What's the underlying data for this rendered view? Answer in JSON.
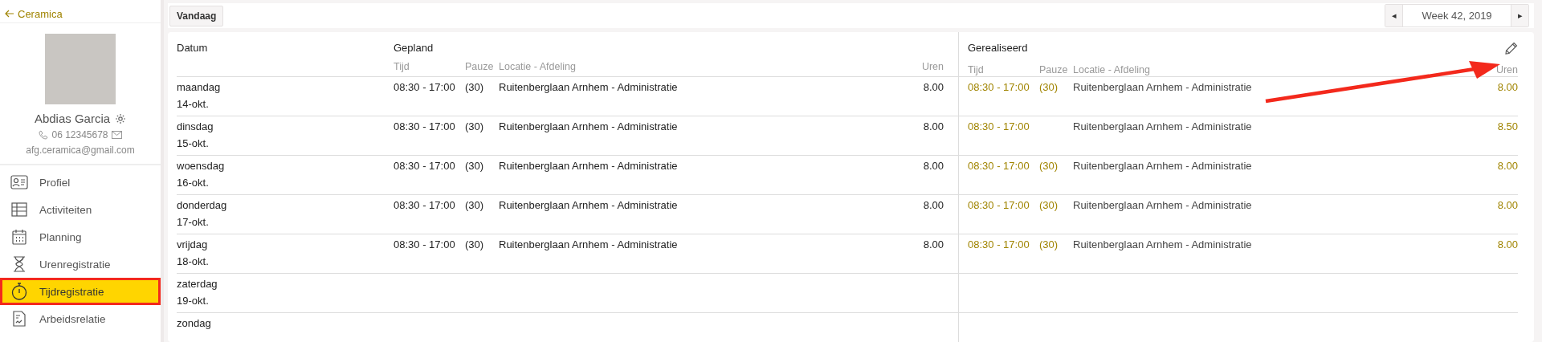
{
  "sidebar": {
    "back_link": "Ceramica",
    "profile": {
      "name": "Abdias Garcia",
      "phone": "06 12345678",
      "email": "afg.ceramica@gmail.com"
    },
    "nav_items": [
      {
        "label": "Profiel",
        "selected": false,
        "highlighted": false
      },
      {
        "label": "Activiteiten",
        "selected": false,
        "highlighted": false
      },
      {
        "label": "Planning",
        "selected": false,
        "highlighted": false
      },
      {
        "label": "Urenregistratie",
        "selected": false,
        "highlighted": false
      },
      {
        "label": "Tijdregistratie",
        "selected": true,
        "highlighted": true
      },
      {
        "label": "Arbeidsrelatie",
        "selected": false,
        "highlighted": false
      }
    ]
  },
  "toolbar": {
    "today_button": "Vandaag",
    "prev": "◂",
    "week": "Week 42, 2019",
    "next": "▸"
  },
  "table": {
    "date_column": "Datum",
    "planned": {
      "title": "Gepland",
      "columns": [
        "Tijd",
        "Pauze",
        "Locatie - Afdeling",
        "Uren"
      ]
    },
    "realized": {
      "title": "Gerealiseerd",
      "columns": [
        "Tijd",
        "Pauze",
        "Locatie - Afdeling",
        "Uren"
      ]
    },
    "rows": [
      {
        "day": "maandag",
        "date": "14-okt.",
        "planned": {
          "time": "08:30 - 17:00",
          "pause": "(30)",
          "location": "Ruitenberglaan Arnhem - Administratie",
          "hours": "8.00"
        },
        "realized": {
          "time": "08:30 - 17:00",
          "pause": "(30)",
          "location": "Ruitenberglaan Arnhem - Administratie",
          "hours": "8.00"
        }
      },
      {
        "day": "dinsdag",
        "date": "15-okt.",
        "planned": {
          "time": "08:30 - 17:00",
          "pause": "(30)",
          "location": "Ruitenberglaan Arnhem - Administratie",
          "hours": "8.00"
        },
        "realized": {
          "time": "08:30 - 17:00",
          "location": "Ruitenberglaan Arnhem - Administratie",
          "hours": "8.50"
        }
      },
      {
        "day": "woensdag",
        "date": "16-okt.",
        "planned": {
          "time": "08:30 - 17:00",
          "pause": "(30)",
          "location": "Ruitenberglaan Arnhem - Administratie",
          "hours": "8.00"
        },
        "realized": {
          "time": "08:30 - 17:00",
          "pause": "(30)",
          "location": "Ruitenberglaan Arnhem - Administratie",
          "hours": "8.00"
        }
      },
      {
        "day": "donderdag",
        "date": "17-okt.",
        "planned": {
          "time": "08:30 - 17:00",
          "pause": "(30)",
          "location": "Ruitenberglaan Arnhem - Administratie",
          "hours": "8.00"
        },
        "realized": {
          "time": "08:30 - 17:00",
          "pause": "(30)",
          "location": "Ruitenberglaan Arnhem - Administratie",
          "hours": "8.00"
        }
      },
      {
        "day": "vrijdag",
        "date": "18-okt.",
        "planned": {
          "time": "08:30 - 17:00",
          "pause": "(30)",
          "location": "Ruitenberglaan Arnhem - Administratie",
          "hours": "8.00"
        },
        "realized": {
          "time": "08:30 - 17:00",
          "pause": "(30)",
          "location": "Ruitenberglaan Arnhem - Administratie",
          "hours": "8.00"
        }
      },
      {
        "day": "zaterdag",
        "date": "19-okt."
      },
      {
        "day": "zondag"
      }
    ]
  }
}
